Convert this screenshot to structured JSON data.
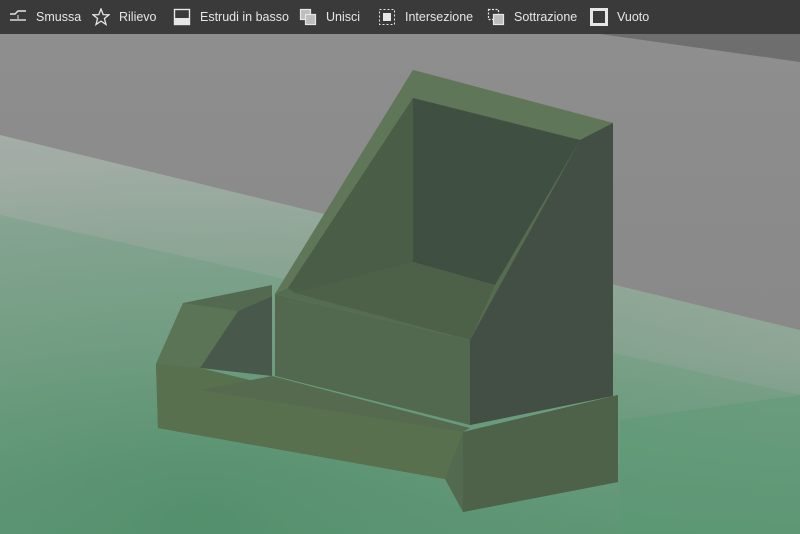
{
  "toolbar": {
    "items": [
      {
        "label": "Smussa",
        "icon": "chamfer-icon"
      },
      {
        "label": "Rilievo",
        "icon": "star-icon"
      },
      {
        "label": "Estrudi in basso",
        "icon": "extrude-down-icon"
      },
      {
        "label": "Unisci",
        "icon": "union-icon"
      },
      {
        "label": "Intersezione",
        "icon": "intersection-icon"
      },
      {
        "label": "Sottrazione",
        "icon": "subtraction-icon"
      },
      {
        "label": "Vuoto",
        "icon": "hollow-icon"
      }
    ]
  },
  "colors": {
    "toolbar_bg": "#3a3a3a",
    "toolbar_text": "#e6e6e6",
    "backdrop": "#8a8a8a",
    "ground": "#a3aca6",
    "model": "#596c52",
    "ground_glow": "#4f8a68"
  }
}
